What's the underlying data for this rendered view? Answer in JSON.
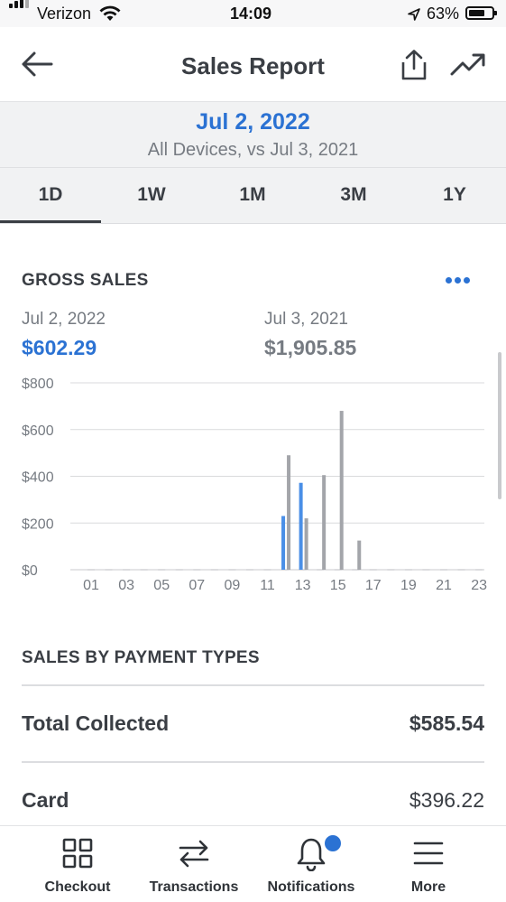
{
  "status_bar": {
    "carrier": "Verizon",
    "time": "14:09",
    "battery": "63%"
  },
  "header": {
    "title": "Sales Report",
    "back_icon": "arrow-left-icon",
    "share_icon": "share-icon",
    "trend_icon": "trending-up-icon"
  },
  "date_bar": {
    "date": "Jul 2, 2022",
    "subtitle": "All Devices, vs Jul 3, 2021"
  },
  "tabs": [
    {
      "label": "1D",
      "active": true
    },
    {
      "label": "1W"
    },
    {
      "label": "1M"
    },
    {
      "label": "3M"
    },
    {
      "label": "1Y"
    }
  ],
  "gross_sales": {
    "title": "GROSS SALES",
    "current": {
      "label": "Jul 2, 2022",
      "value": "$602.29",
      "color": "#2b72d3"
    },
    "previous": {
      "label": "Jul 3, 2021",
      "value": "$1,905.85",
      "color": "#767b82"
    }
  },
  "chart_data": {
    "type": "bar",
    "x_ticks": [
      "01",
      "03",
      "05",
      "07",
      "09",
      "11",
      "13",
      "15",
      "17",
      "19",
      "21",
      "23"
    ],
    "y_ticks": [
      "$0",
      "$200",
      "$400",
      "$600",
      "$800"
    ],
    "ylim": [
      0,
      800
    ],
    "series": [
      {
        "color": "#4a8fe7",
        "points": [
          {
            "hour": 12,
            "value": 230
          },
          {
            "hour": 13,
            "value": 372
          }
        ]
      },
      {
        "color": "#a3a5aa",
        "points": [
          {
            "hour": 12,
            "value": 490
          },
          {
            "hour": 13,
            "value": 220
          },
          {
            "hour": 14,
            "value": 405
          },
          {
            "hour": 15,
            "value": 680
          },
          {
            "hour": 16,
            "value": 125
          }
        ]
      }
    ]
  },
  "payment_types": {
    "title": "SALES BY PAYMENT TYPES",
    "rows": [
      {
        "label": "Total Collected",
        "value": "$585.54"
      },
      {
        "label": "Card",
        "value": "$396.22"
      }
    ]
  },
  "bottom_nav": [
    {
      "label": "Checkout",
      "icon": "grid-icon"
    },
    {
      "label": "Transactions",
      "icon": "swap-arrows-icon"
    },
    {
      "label": "Notifications",
      "icon": "bell-icon",
      "badge": true
    },
    {
      "label": "More",
      "icon": "menu-icon"
    }
  ]
}
